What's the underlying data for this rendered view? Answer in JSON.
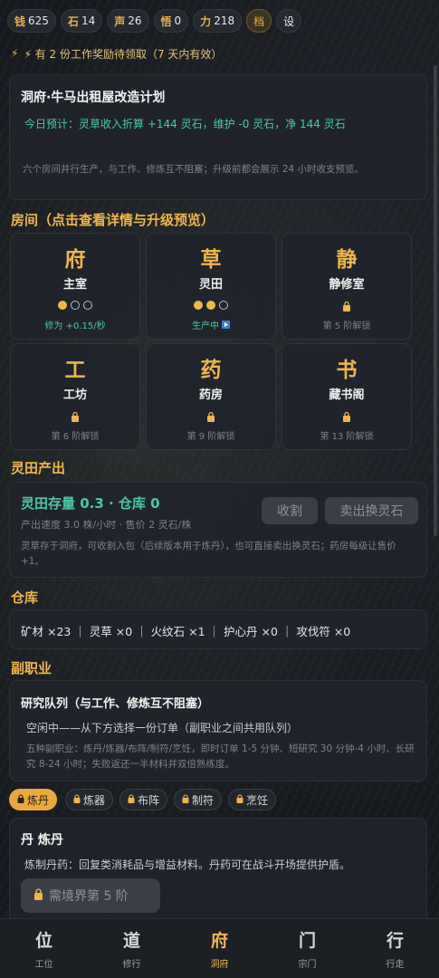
{
  "resources": [
    {
      "key": "钱",
      "value": "625"
    },
    {
      "key": "石",
      "value": "14"
    },
    {
      "key": "声",
      "value": "26"
    },
    {
      "key": "悟",
      "value": "0"
    },
    {
      "key": "力",
      "value": "218"
    }
  ],
  "top_buttons": {
    "save": "档",
    "settings": "设"
  },
  "notice": "⚡ 有 2 份工作奖励待领取（7 天内有效）",
  "plan": {
    "title": "洞府·牛马出租屋改造计划",
    "forecast": "今日预计：灵草收入折算 +144 灵石，维护 -0 灵石，净 144 灵石",
    "note": "六个房间并行生产，与工作、修炼互不阻塞；升级前都会展示 24 小时收支预览。"
  },
  "rooms_header": "房间（点击查看详情与升级预览）",
  "rooms": [
    {
      "glyph": "府",
      "name": "主室",
      "dots": [
        true,
        false,
        false
      ],
      "status": "修为 +0.15/秒"
    },
    {
      "glyph": "草",
      "name": "灵田",
      "dots": [
        true,
        true,
        false
      ],
      "status": "生产中"
    },
    {
      "glyph": "静",
      "name": "静修室",
      "status": "第 5 阶解锁"
    },
    {
      "glyph": "工",
      "name": "工坊",
      "status": "第 6 阶解锁"
    },
    {
      "glyph": "药",
      "name": "药房",
      "status": "第 9 阶解锁"
    },
    {
      "glyph": "书",
      "name": "藏书阁",
      "status": "第 13 阶解锁"
    }
  ],
  "field": {
    "header": "灵田产出",
    "stock": "灵田存量 0.3 · 仓库 0",
    "rate": "产出速度 3.0 株/小时 · 售价 2 灵石/株",
    "harvest_btn": "收割",
    "sell_btn": "卖出换灵石",
    "note": "灵草存于洞府，可收割入包（后续版本用于炼丹），也可直接卖出换灵石；药房每级让售价 +1。"
  },
  "warehouse": {
    "header": "仓库",
    "items": "矿材 ×23 ｜ 灵草 ×0 ｜ 火纹石 ×1 ｜ 护心丹 ×0 ｜ 攻伐符 ×0"
  },
  "sidejob": {
    "header": "副职业",
    "queue_title": "研究队列（与工作、修炼互不阻塞）",
    "queue_status": "空闲中——从下方选择一份订单（副职业之间共用队列）",
    "queue_note": "五种副职业：炼丹/炼器/布阵/制符/烹饪，即时订单 1-5 分钟、短研究 30 分钟-4 小时、长研究 8-24 小时；失败返还一半材料并双倍熟练度。",
    "tabs": [
      "炼丹",
      "炼器",
      "布阵",
      "制符",
      "烹饪"
    ],
    "alchemy_title": "丹 炼丹",
    "alchemy_desc": "炼制丹药：回复类消耗品与增益材料。丹药可在战斗开场提供护盾。",
    "alchemy_lock": "需境界第 5 阶"
  },
  "nav": [
    {
      "glyph": "位",
      "label": "工位"
    },
    {
      "glyph": "道",
      "label": "修行"
    },
    {
      "glyph": "府",
      "label": "洞府",
      "active": true
    },
    {
      "glyph": "门",
      "label": "宗门"
    },
    {
      "glyph": "行",
      "label": "行走"
    }
  ],
  "colors": {
    "accent": "#f0b64a",
    "green": "#49c9a6",
    "panel": "#20242b"
  }
}
